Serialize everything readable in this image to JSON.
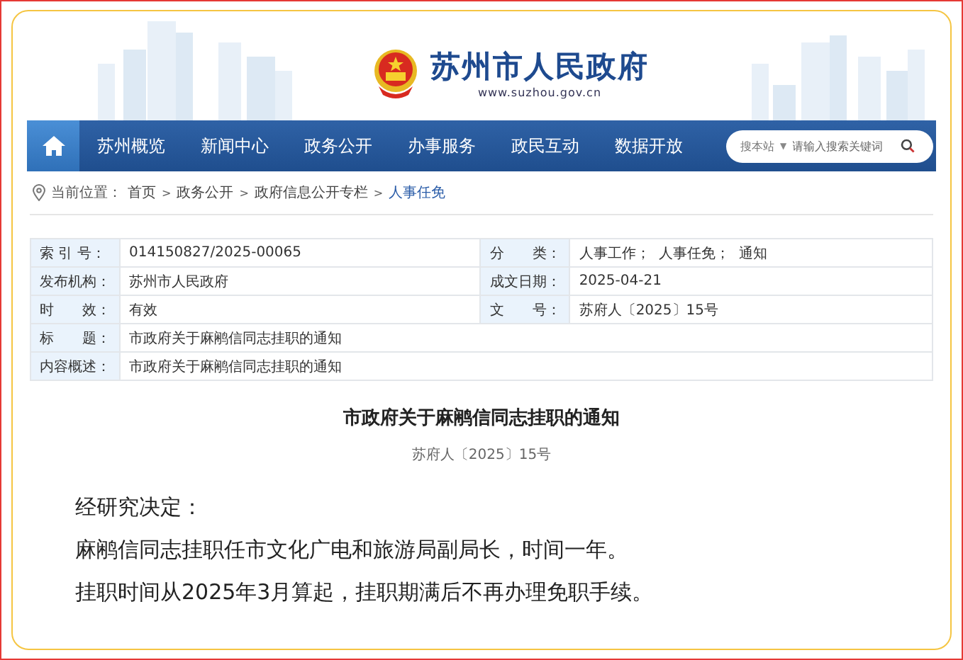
{
  "header": {
    "title": "苏州市人民政府",
    "url": "www.suzhou.gov.cn"
  },
  "nav": {
    "items": [
      {
        "label": "苏州概览"
      },
      {
        "label": "新闻中心"
      },
      {
        "label": "政务公开"
      },
      {
        "label": "办事服务"
      },
      {
        "label": "政民互动"
      },
      {
        "label": "数据开放"
      }
    ]
  },
  "search": {
    "scope": "搜本站",
    "caret": "▼",
    "placeholder": "请输入搜索关键词"
  },
  "breadcrumb": {
    "label": "当前位置：",
    "separator": ">",
    "items": [
      "首页",
      "政务公开",
      "政府信息公开专栏",
      "人事任免"
    ]
  },
  "meta_table": {
    "rows": [
      {
        "cells": [
          {
            "label": "索 引 号：",
            "value": "014150827/2025-00065"
          },
          {
            "label": "分　　类：",
            "value": "人事工作；  人事任免；  通知"
          }
        ]
      },
      {
        "cells": [
          {
            "label": "发布机构：",
            "value": "苏州市人民政府"
          },
          {
            "label": "成文日期：",
            "value": "2025-04-21"
          }
        ]
      },
      {
        "cells": [
          {
            "label": "时　　效：",
            "value": "有效"
          },
          {
            "label": "文　　号：",
            "value": "苏府人〔2025〕15号"
          }
        ]
      },
      {
        "cells": [
          {
            "label": "标　　题：",
            "value": "市政府关于麻鹇信同志挂职的通知"
          }
        ]
      },
      {
        "cells": [
          {
            "label": "内容概述：",
            "value": "市政府关于麻鹇信同志挂职的通知"
          }
        ]
      }
    ]
  },
  "article": {
    "title": "市政府关于麻鹇信同志挂职的通知",
    "doc_number": "苏府人〔2025〕15号",
    "paragraphs": [
      "经研究决定：",
      "麻鹇信同志挂职任市文化广电和旅游局副局长，时间一年。",
      "挂职时间从2025年3月算起，挂职期满后不再办理免职手续。"
    ]
  }
}
